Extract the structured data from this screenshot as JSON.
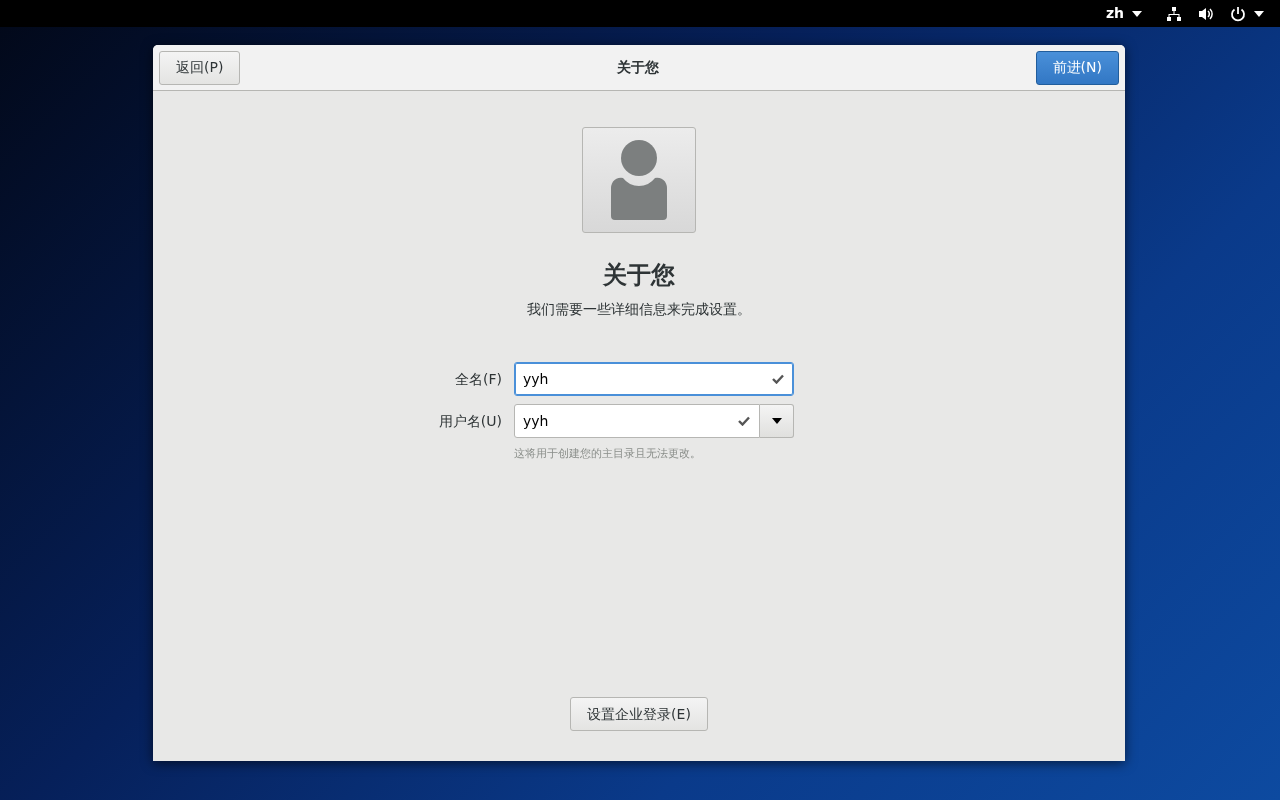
{
  "top_bar": {
    "language": "zh"
  },
  "window": {
    "title": "关于您",
    "back_button": "返回(P)",
    "next_button": "前进(N)"
  },
  "heading": "关于您",
  "subtitle": "我们需要一些详细信息来完成设置。",
  "fields": [
    {
      "kind": "text",
      "label": "全名(F)",
      "value": "yyh",
      "focused": true,
      "valid": true
    },
    {
      "kind": "combo",
      "label": "用户名(U)",
      "value": "yyh",
      "focused": false,
      "valid": true
    }
  ],
  "hint": "这将用于创建您的主目录且无法更改。",
  "enterprise_button": "设置企业登录(E)"
}
